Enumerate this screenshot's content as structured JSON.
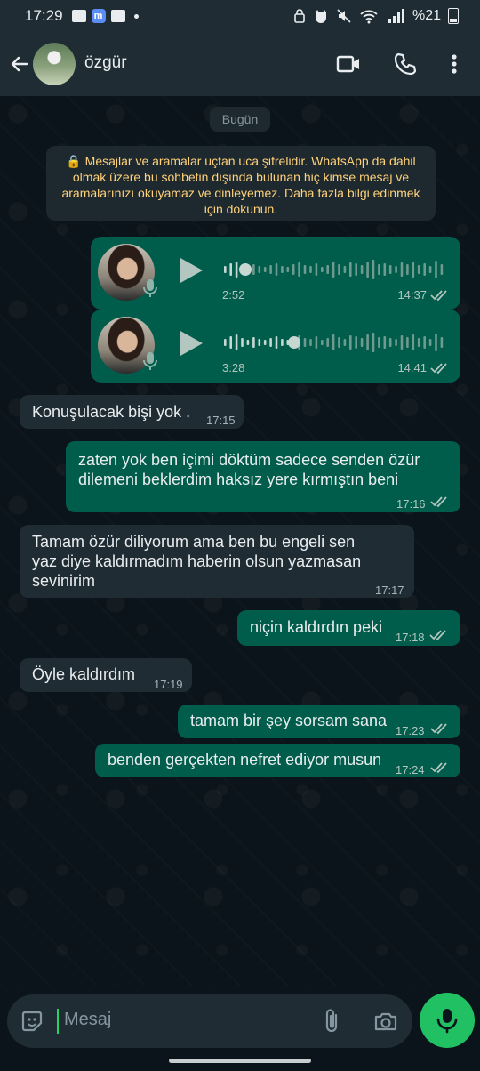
{
  "status_bar": {
    "time": "17:29",
    "battery": "%21"
  },
  "header": {
    "contact_name": "özgür"
  },
  "chat": {
    "date_label": "Bugün",
    "encryption_notice": "🔒 Mesajlar ve aramalar uçtan uca şifrelidir. WhatsApp da dahil olmak üzere bu sohbetin dışında bulunan hiç kimse mesaj ve aramalarınızı okuyamaz ve dinleyemez. Daha fazla bilgi edinmek için dokunun.",
    "voice_messages": [
      {
        "duration": "2:52",
        "time": "14:37",
        "direction": "out",
        "read": true,
        "progress": 0.08
      },
      {
        "duration": "3:28",
        "time": "14:41",
        "direction": "out",
        "read": true,
        "progress": 0.3
      }
    ],
    "messages": [
      {
        "direction": "in",
        "text": "Konuşulacak bişi yok .",
        "time": "17:15"
      },
      {
        "direction": "out",
        "text": "zaten yok ben içimi döktüm sadece senden özür dilemeni beklerdim haksız yere kırmıştın beni",
        "time": "17:16",
        "read": true
      },
      {
        "direction": "in",
        "text": "Tamam özür diliyorum ama ben bu engeli sen yaz diye kaldırmadım haberin olsun yazmasan sevinirim",
        "time": "17:17"
      },
      {
        "direction": "out",
        "text": "niçin kaldırdın peki",
        "time": "17:18",
        "read": true
      },
      {
        "direction": "in",
        "text": "Öyle kaldırdım",
        "time": "17:19"
      },
      {
        "direction": "out",
        "text": "tamam bir şey sorsam sana",
        "time": "17:23",
        "read": true
      },
      {
        "direction": "out",
        "text": "benden gerçekten nefret ediyor musun",
        "time": "17:24",
        "read": true
      }
    ]
  },
  "composer": {
    "placeholder": "Mesaj"
  },
  "colors": {
    "background": "#0b141a",
    "bar": "#1f2c34",
    "incoming": "#202c33",
    "outgoing": "#005c4b",
    "accent": "#21c063",
    "notice_text": "#ffd279"
  },
  "icons": [
    "back-arrow-icon",
    "video-call-icon",
    "phone-icon",
    "more-vert-icon",
    "play-icon",
    "mic-icon",
    "double-check-icon",
    "sticker-icon",
    "attach-icon",
    "camera-icon"
  ]
}
